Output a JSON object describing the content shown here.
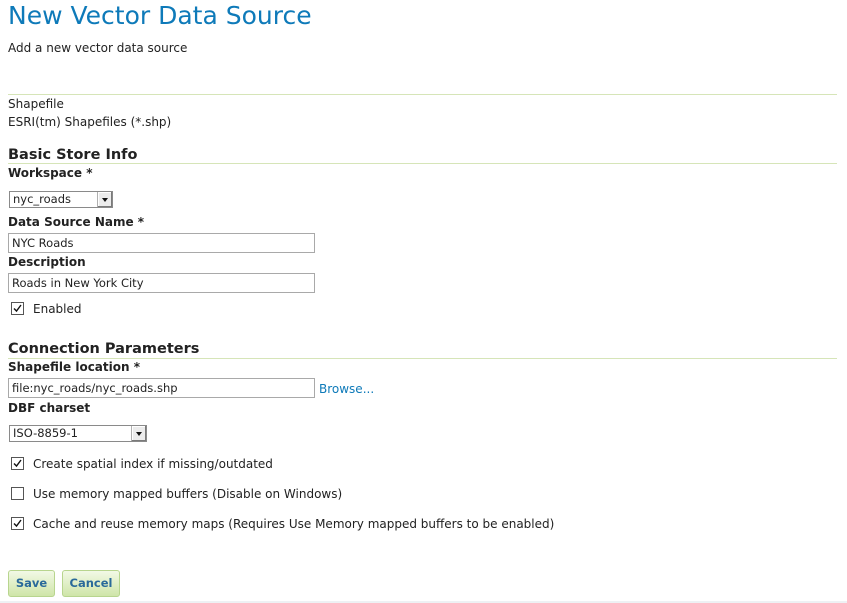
{
  "header": {
    "title": "New Vector Data Source",
    "description": "Add a new vector data source"
  },
  "store_type": {
    "name": "Shapefile",
    "description": "ESRI(tm) Shapefiles (*.shp)"
  },
  "basic_info": {
    "section_title": "Basic Store Info",
    "workspace_label": "Workspace *",
    "workspace_value": "nyc_roads",
    "name_label": "Data Source Name *",
    "name_value": "NYC Roads",
    "description_label": "Description",
    "description_value": "Roads in New York City",
    "enabled_label": "Enabled",
    "enabled_checked": true
  },
  "connection": {
    "section_title": "Connection Parameters",
    "location_label": "Shapefile location *",
    "location_value": "file:nyc_roads/nyc_roads.shp",
    "browse_label": "Browse...",
    "charset_label": "DBF charset",
    "charset_value": "ISO-8859-1",
    "options": [
      {
        "label": "Create spatial index if missing/outdated",
        "checked": true
      },
      {
        "label": "Use memory mapped buffers (Disable on Windows)",
        "checked": false
      },
      {
        "label": "Cache and reuse memory maps (Requires Use Memory mapped buffers to be enabled)",
        "checked": true
      }
    ]
  },
  "actions": {
    "save_label": "Save",
    "cancel_label": "Cancel"
  },
  "colors": {
    "title": "#0e7ab9",
    "link": "#0e7ab9",
    "divider": "#d6e5b8",
    "button_bg": "#cfe5a8"
  }
}
